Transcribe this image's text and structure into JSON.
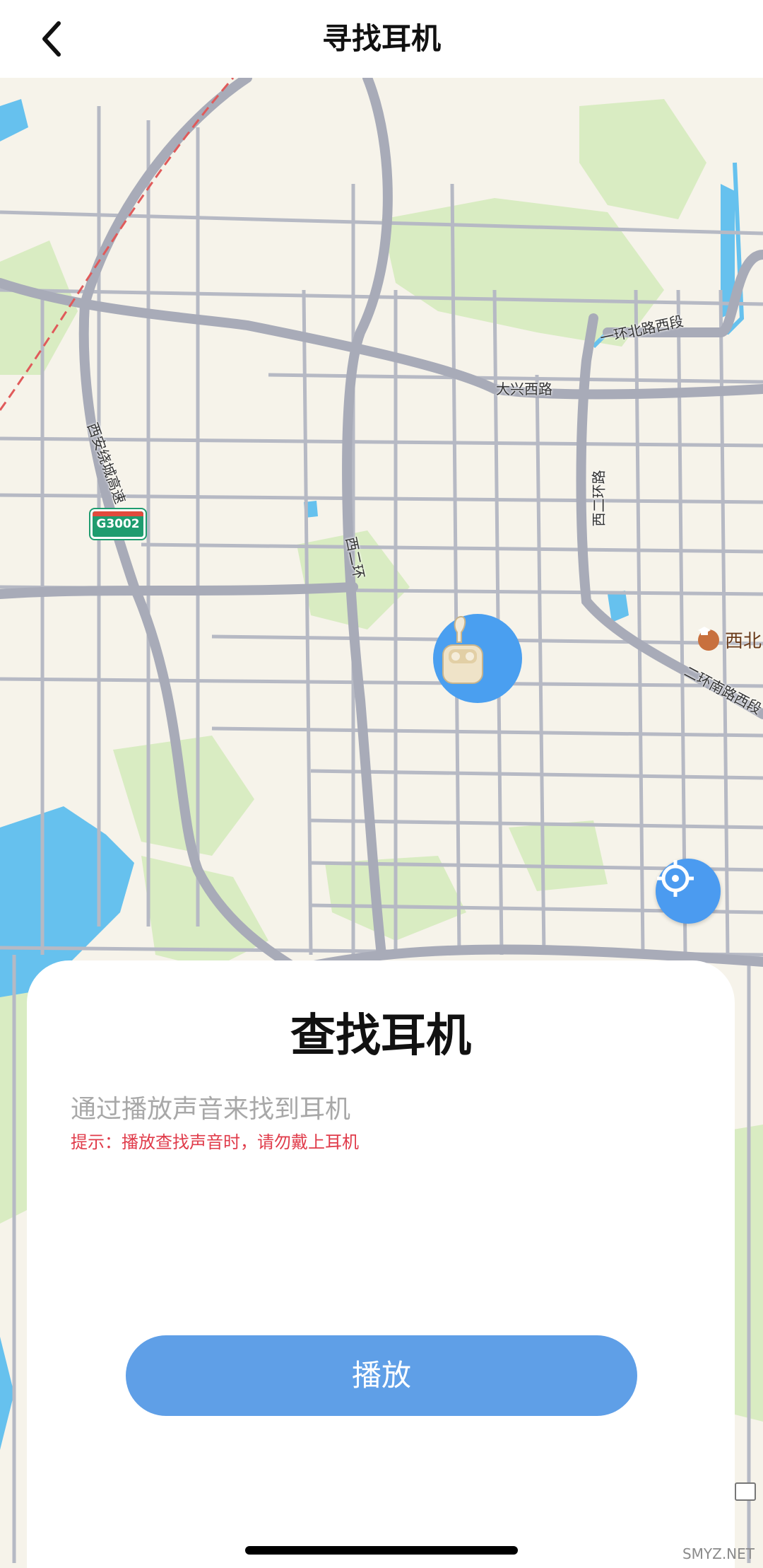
{
  "header": {
    "title": "寻找耳机",
    "back_icon": "chevron-left-icon"
  },
  "map": {
    "road_labels": [
      "一环北路西段",
      "大兴西路",
      "西安绕城高速",
      "西二环",
      "西二环路",
      "二环南路西段"
    ],
    "highway_badge": "G3002",
    "poi_label": "西北",
    "poi_icon": "graduation-cap-icon",
    "device_icon": "earbuds-case-icon",
    "locate_icon": "crosshair-icon"
  },
  "sheet": {
    "title": "查找耳机",
    "description": "通过播放声音来找到耳机",
    "tip": "提示：播放查找声音时，请勿戴上耳机",
    "play_label": "播放"
  },
  "watermark": "SMYZ.NET",
  "colors": {
    "accent": "#5f9fe7",
    "tip": "#e03b4a",
    "pin": "#4a9ff0",
    "road": "#b6b9c4",
    "water": "#66c1ee",
    "park": "#d9ecc2"
  }
}
